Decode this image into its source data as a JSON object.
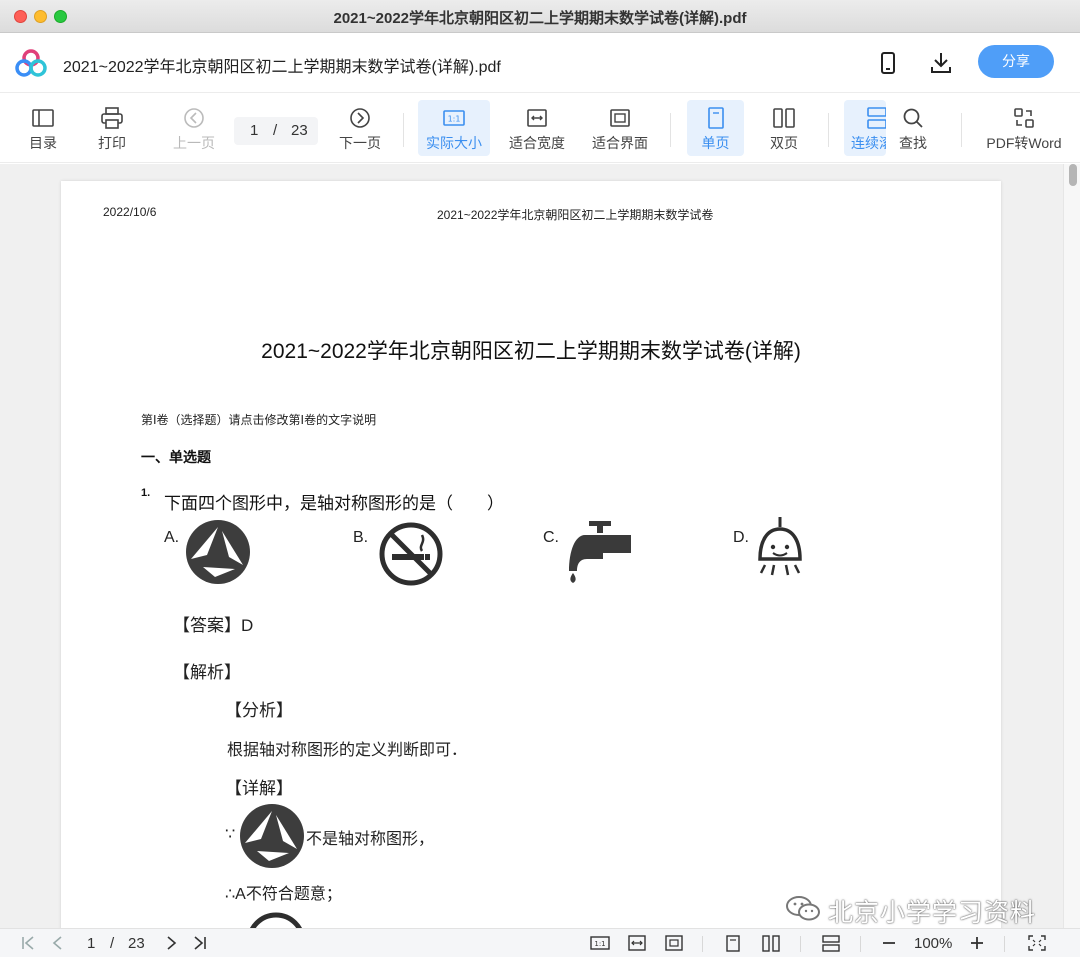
{
  "window": {
    "title": "2021~2022学年北京朝阳区初二上学期期末数学试卷(详解).pdf"
  },
  "header": {
    "doc_title": "2021~2022学年北京朝阳区初二上学期期末数学试卷(详解).pdf",
    "share_label": "分享"
  },
  "toolbar": {
    "toc": "目录",
    "print": "打印",
    "prev": "上一页",
    "page_current": "1",
    "page_sep": "/",
    "page_total": "23",
    "next": "下一页",
    "actual_size": "实际大小",
    "fit_width": "适合宽度",
    "fit_page": "适合界面",
    "single_page": "单页",
    "double_page": "双页",
    "continuous": "连续滚",
    "find": "查找",
    "pdf_to_word": "PDF转Word"
  },
  "document": {
    "date": "2022/10/6",
    "running_header": "2021~2022学年北京朝阳区初二上学期期末数学试卷",
    "title": "2021~2022学年北京朝阳区初二上学期期末数学试卷(详解)",
    "note": "第Ⅰ卷（选择题）请点击修改第Ⅰ卷的文字说明",
    "section": "一、单选题",
    "question_number": "1.",
    "question": "下面四个图形中，是轴对称图形的是（　　）",
    "options": [
      {
        "label": "A.",
        "figure": "triangle-logo-icon"
      },
      {
        "label": "B.",
        "figure": "no-smoking-icon"
      },
      {
        "label": "C.",
        "figure": "faucet-icon"
      },
      {
        "label": "D.",
        "figure": "lamp-icon"
      }
    ],
    "answer": "【答案】D",
    "analysis_heading": "【解析】",
    "analysis_sub": "【分析】",
    "analysis_text": "根据轴对称图形的定义判断即可．",
    "detail_heading": "【详解】",
    "because": "∵",
    "not_symmetric": "不是轴对称图形，",
    "therefore": "∴A不符合题意；"
  },
  "watermark": "北京小学学习资料",
  "bottombar": {
    "page_current": "1",
    "page_sep": "/",
    "page_total": "23",
    "zoom": "100%"
  },
  "colors": {
    "accent": "#4f9ef8",
    "active_bg": "#e7f1fd",
    "icon_dark": "#3d3d3d"
  }
}
